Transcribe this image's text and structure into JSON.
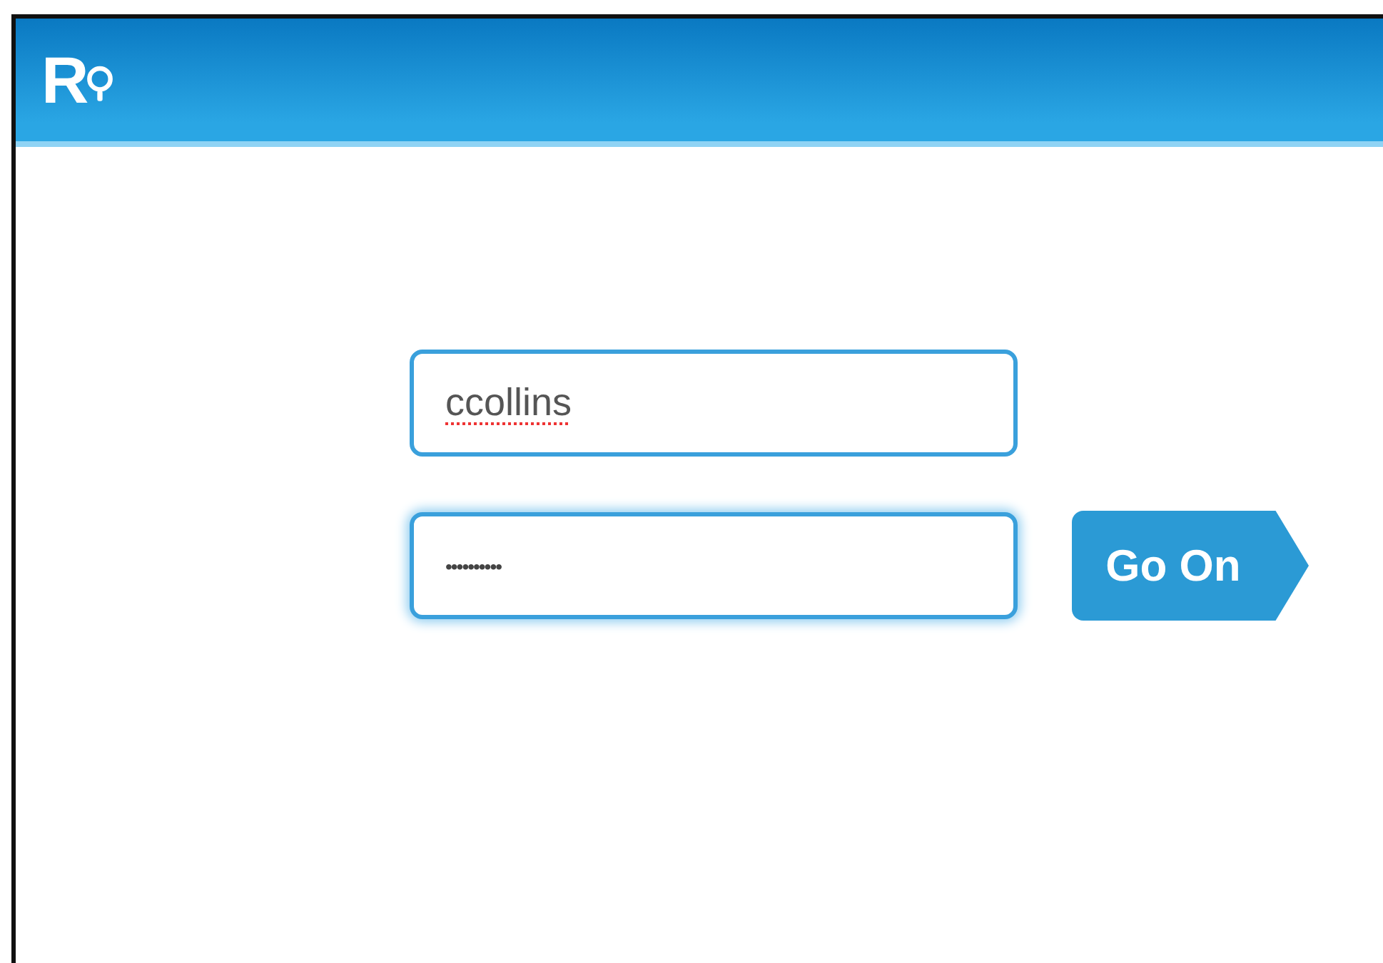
{
  "header": {
    "logo": "R"
  },
  "fields": [
    {
      "kind": "text",
      "value": "ccollins",
      "focused": false,
      "spell_error": true
    },
    {
      "kind": "password",
      "value": "••••••••••",
      "focused": true,
      "spell_error": false
    }
  ],
  "button": {
    "label": "Go On"
  }
}
